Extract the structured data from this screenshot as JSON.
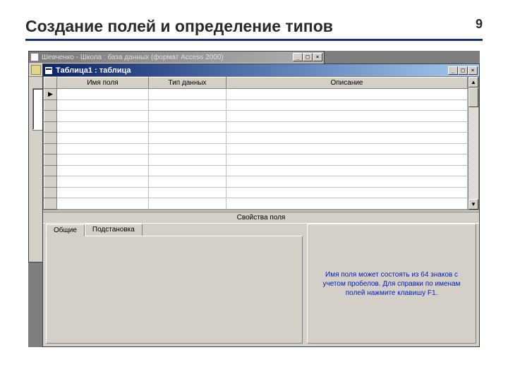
{
  "slide": {
    "title": "Создание полей и определение типов",
    "number": "9"
  },
  "db_window": {
    "title": "Шевченко - Школа : база данных (формат Access 2000)",
    "controls": {
      "min": "_",
      "max": "□",
      "close": "×"
    }
  },
  "table_window": {
    "title": "Таблица1 : таблица",
    "controls": {
      "min": "_",
      "max": "□",
      "close": "×"
    },
    "columns": {
      "field_name": "Имя поля",
      "data_type": "Тип данных",
      "description": "Описание"
    },
    "current_row_marker": "▶",
    "scroll": {
      "up": "▲",
      "down": "▼"
    }
  },
  "properties": {
    "header": "Свойства поля",
    "tabs": {
      "general": "Общие",
      "lookup": "Подстановка"
    },
    "help": "Имя поля может состоять из 64 знаков с учетом пробелов.  Для справки по именам полей нажмите клавишу F1."
  }
}
